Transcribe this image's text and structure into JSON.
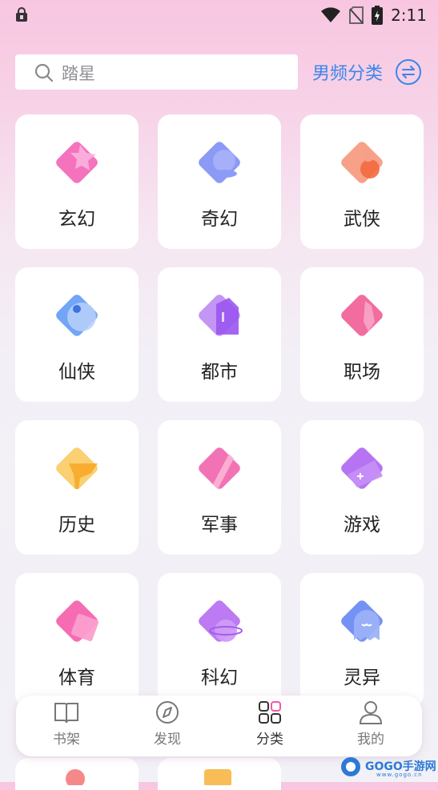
{
  "status_bar": {
    "time": "2:11"
  },
  "search": {
    "placeholder": "踏星"
  },
  "gender_switch": {
    "label": "男频分类"
  },
  "categories": [
    {
      "label": "玄幻",
      "icon": "fantasy-icon",
      "color": "#f25bb0"
    },
    {
      "label": "奇幻",
      "icon": "crystal-ball-icon",
      "color": "#6f7ff2"
    },
    {
      "label": "武侠",
      "icon": "gourd-icon",
      "color": "#f06a4a"
    },
    {
      "label": "仙侠",
      "icon": "yin-yang-icon",
      "color": "#4d8ff2"
    },
    {
      "label": "都市",
      "icon": "building-icon",
      "color": "#a463f0"
    },
    {
      "label": "职场",
      "icon": "tie-icon",
      "color": "#f0528f"
    },
    {
      "label": "历史",
      "icon": "flag-icon",
      "color": "#f7b23a"
    },
    {
      "label": "军事",
      "icon": "sword-icon",
      "color": "#f05aa8"
    },
    {
      "label": "游戏",
      "icon": "gamepad-icon",
      "color": "#a95cf0"
    },
    {
      "label": "体育",
      "icon": "jersey-icon",
      "color": "#f452a6"
    },
    {
      "label": "科幻",
      "icon": "planet-icon",
      "color": "#b064f0"
    },
    {
      "label": "灵异",
      "icon": "ghost-icon",
      "color": "#5c7ff2"
    }
  ],
  "tabs": [
    {
      "label": "书架",
      "icon": "book-icon"
    },
    {
      "label": "发现",
      "icon": "compass-icon"
    },
    {
      "label": "分类",
      "icon": "grid-icon"
    },
    {
      "label": "我的",
      "icon": "user-icon"
    }
  ],
  "watermark": {
    "text": "GOGO手游网",
    "sub": "www.gogo.cn"
  }
}
